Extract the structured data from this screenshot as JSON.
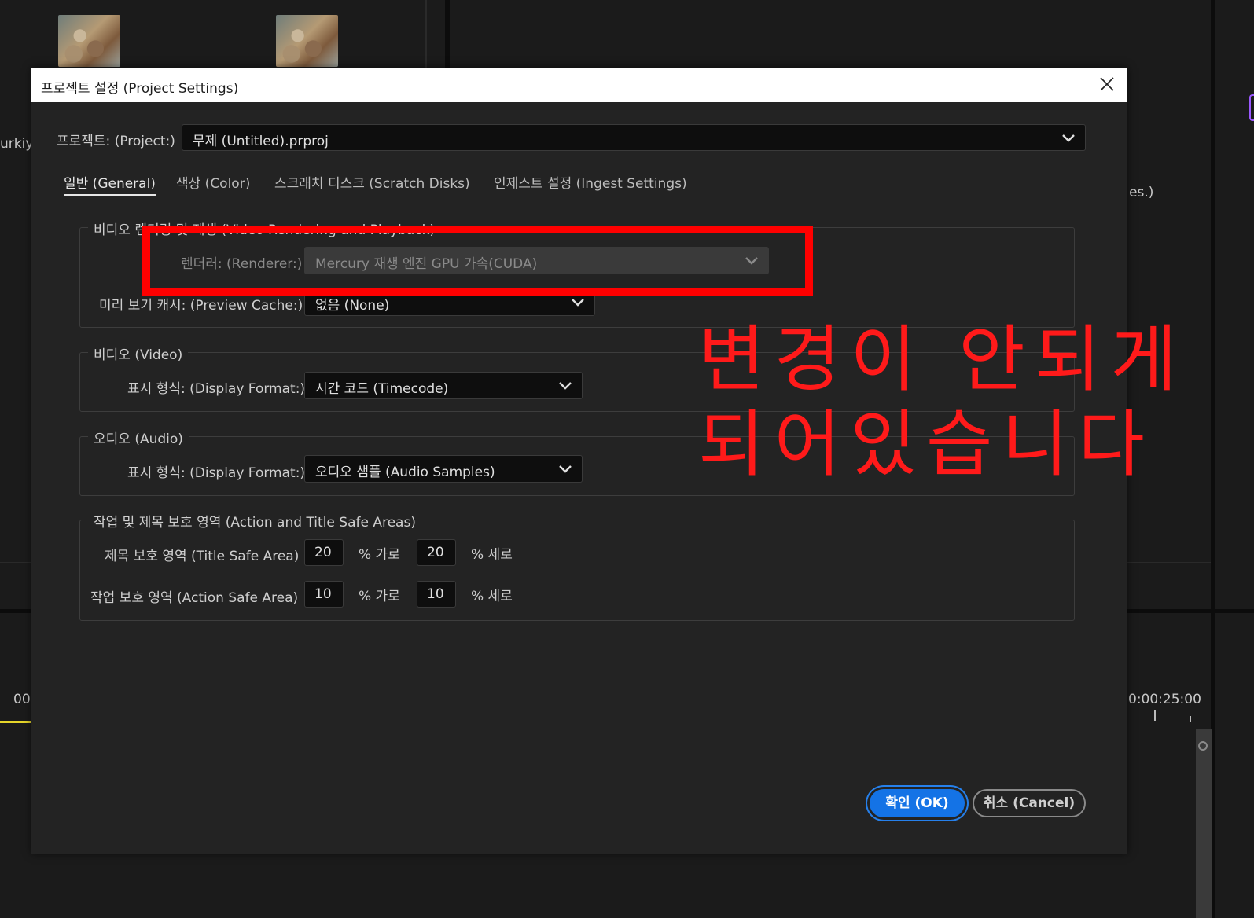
{
  "background": {
    "left_text": "urkiye",
    "right_text": "es.)",
    "timecode_left": "00",
    "timecode_right": "0:00:25:00"
  },
  "dialog": {
    "title": "프로젝트 설정 (Project Settings)",
    "project_label": "프로젝트: (Project:)",
    "project_value": "무제 (Untitled).prproj",
    "tabs": [
      {
        "label": "일반 (General)",
        "active": true
      },
      {
        "label": "색상 (Color)"
      },
      {
        "label": "스크래치 디스크 (Scratch Disks)"
      },
      {
        "label": "인제스트 설정 (Ingest Settings)"
      }
    ],
    "video_rendering": {
      "legend": "비디오 렌더링 및 재생 (Video Rendering and Playback)",
      "renderer_label": "렌더러: (Renderer:)",
      "renderer_value": "Mercury 재생 엔진 GPU 가속(CUDA)",
      "preview_cache_label": "미리 보기 캐시: (Preview Cache:)",
      "preview_cache_value": "없음 (None)"
    },
    "video": {
      "legend": "비디오 (Video)",
      "display_format_label": "표시 형식: (Display Format:)",
      "display_format_value": "시간 코드 (Timecode)"
    },
    "audio": {
      "legend": "오디오 (Audio)",
      "display_format_label": "표시 형식: (Display Format:)",
      "display_format_value": "오디오 샘플 (Audio Samples)"
    },
    "safe_areas": {
      "legend": "작업 및 제목 보호 영역 (Action and Title Safe Areas)",
      "title_label": "제목 보호 영역 (Title Safe Area)",
      "title_h": "20",
      "title_v": "20",
      "action_label": "작업 보호 영역 (Action Safe Area)",
      "action_h": "10",
      "action_v": "10",
      "unit_h": "% 가로",
      "unit_v": "% 세로"
    },
    "ok_label": "확인 (OK)",
    "cancel_label": "취소 (Cancel)"
  },
  "annotation": {
    "line1": "변경이 안되게",
    "line2": "되어있습니다",
    "color": "#ff0000"
  }
}
